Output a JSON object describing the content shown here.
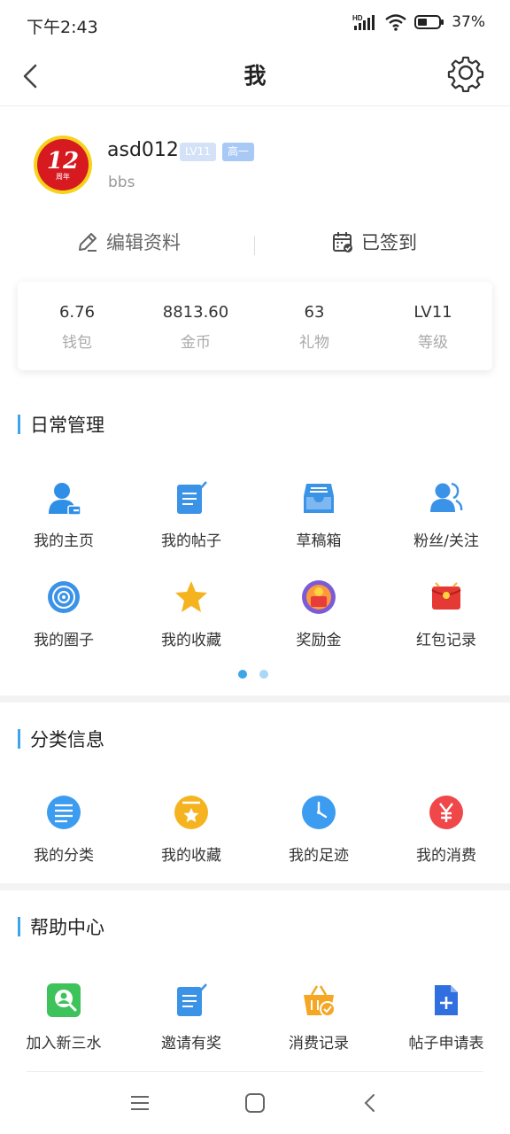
{
  "status_bar": {
    "time": "下午2:43",
    "hd": "HD",
    "battery": "37%"
  },
  "nav": {
    "title": "我"
  },
  "profile": {
    "avatar_text": "12",
    "avatar_subtext": "周年",
    "username": "asd012",
    "level_badge": "LV11",
    "grade_badge": "高一",
    "subtitle": "bbs",
    "edit_label": "编辑资料",
    "signed_label": "已签到"
  },
  "stats": [
    {
      "value": "6.76",
      "label": "钱包"
    },
    {
      "value": "8813.60",
      "label": "金币"
    },
    {
      "value": "63",
      "label": "礼物"
    },
    {
      "value": "LV11",
      "label": "等级"
    }
  ],
  "daily": {
    "title": "日常管理",
    "items": [
      {
        "label": "我的主页",
        "icon": "user-home-icon"
      },
      {
        "label": "我的帖子",
        "icon": "post-edit-icon"
      },
      {
        "label": "草稿箱",
        "icon": "draft-box-icon"
      },
      {
        "label": "粉丝/关注",
        "icon": "fans-icon"
      },
      {
        "label": "我的圈子",
        "icon": "circle-icon"
      },
      {
        "label": "我的收藏",
        "icon": "star-icon"
      },
      {
        "label": "奖励金",
        "icon": "reward-icon"
      },
      {
        "label": "红包记录",
        "icon": "red-envelope-icon"
      }
    ]
  },
  "category": {
    "title": "分类信息",
    "items": [
      {
        "label": "我的分类",
        "icon": "list-icon"
      },
      {
        "label": "我的收藏",
        "icon": "bookmark-star-icon"
      },
      {
        "label": "我的足迹",
        "icon": "clock-icon"
      },
      {
        "label": "我的消费",
        "icon": "yen-icon"
      }
    ]
  },
  "help": {
    "title": "帮助中心",
    "items": [
      {
        "label": "加入新三水",
        "icon": "join-icon"
      },
      {
        "label": "邀请有奖",
        "icon": "invite-icon"
      },
      {
        "label": "消费记录",
        "icon": "basket-icon"
      },
      {
        "label": "帖子申请表",
        "icon": "add-document-icon"
      }
    ]
  },
  "colors": {
    "accent": "#3ea6e8",
    "level_badge_bg": "#d4e2f7",
    "grade_badge_bg": "#a8c8f5",
    "separator": "#f3f3f3"
  }
}
